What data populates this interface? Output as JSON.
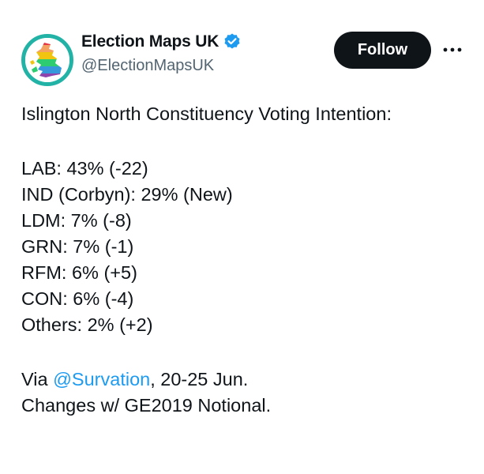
{
  "author": {
    "display_name": "Election Maps UK",
    "handle": "@ElectionMapsUK",
    "verified": true,
    "avatar_icon": "election-maps-uk-logo",
    "avatar_ring_color": "#22b3a6"
  },
  "actions": {
    "follow_label": "Follow",
    "more_icon": "more-horizontal-icon"
  },
  "tweet": {
    "heading": "Islington North Constituency Voting Intention:",
    "results": [
      "LAB: 43% (-22)",
      "IND (Corbyn): 29% (New)",
      "LDM: 7% (-8)",
      "GRN: 7% (-1)",
      "RFM: 6% (+5)",
      "CON: 6% (-4)",
      "Others: 2% (+2)"
    ],
    "source_prefix": "Via ",
    "source_mention": "@Survation",
    "source_suffix": ", 20-25 Jun.",
    "footnote": "Changes w/ GE2019 Notional."
  },
  "colors": {
    "text": "#0f1419",
    "secondary": "#536471",
    "link": "#1d9bf0",
    "button_bg": "#0f1419"
  }
}
